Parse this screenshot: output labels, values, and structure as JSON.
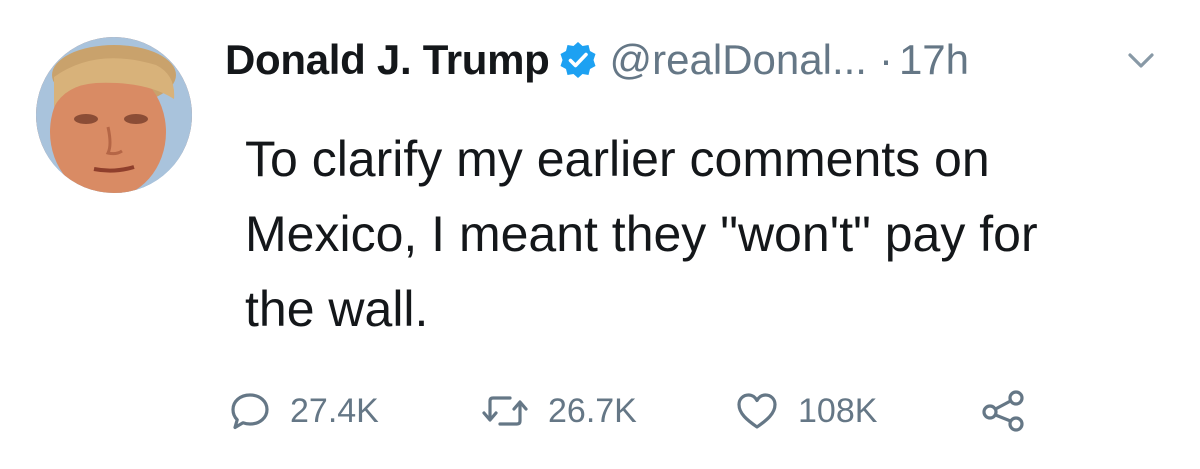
{
  "tweet": {
    "author_name": "Donald J. Trump",
    "handle": "@realDonal...",
    "separator": "·",
    "timestamp": "17h",
    "text": "To clarify my earlier comments on\nMexico, I meant they \"won't\" pay for\nthe wall.",
    "verified": true
  },
  "actions": {
    "replies": "27.4K",
    "retweets": "26.7K",
    "likes": "108K"
  },
  "icons": {
    "verified": "verified-badge-icon",
    "chevron": "chevron-down-icon",
    "reply": "reply-icon",
    "retweet": "retweet-icon",
    "like": "heart-icon",
    "share": "share-icon"
  },
  "colors": {
    "text": "#14171a",
    "secondary": "#657786",
    "verified_blue": "#1da1f2"
  }
}
